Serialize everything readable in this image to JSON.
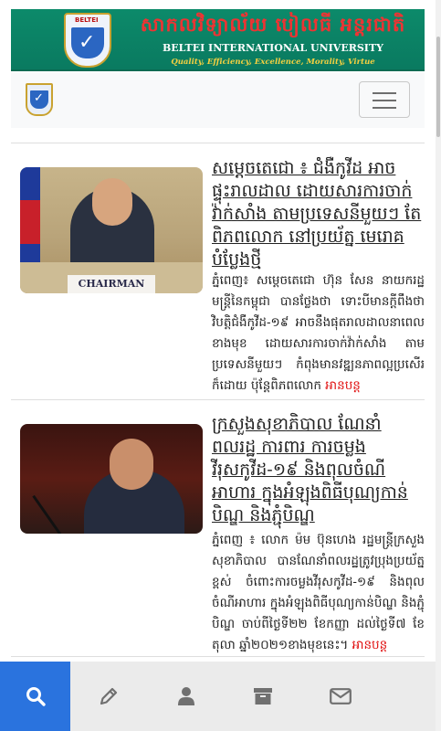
{
  "header": {
    "university_name_km": "សាកលវិទ្យាល័យ បៀលធី អន្តរជាតិ",
    "university_name_en": "BELTEI INTERNATIONAL UNIVERSITY",
    "motto": "Quality, Efficiency, Excellence, Morality, Virtue",
    "logo_caption": "BELTEI"
  },
  "navbar": {
    "brand_icon": "beltei-logo-icon",
    "menu_icon": "hamburger-icon"
  },
  "articles": [
    {
      "headline": "សម្តេចតេជោ ៖ ជំងឺកូវីដ អាចផ្ទុះរាលដាល ដោយសារការចាក់វ៉ាក់សាំង តាមប្រទេសនីមួយៗ តែពិភពលោក នៅប្រយ័ត្ន មេរោគបំប្លែងថ្មី",
      "summary": "ភ្នំពេញ៖ សម្តេចតេជោ ហ៊ុន សែន នាយករដ្ឋមន្ត្រីនៃកម្ពុជា បានថ្លែងថា ទោះបីមានក្តីពឹងថា វិបត្តិជំងឺកូវីដ-១៩ អាចនឹងផុតរាលដាលនាពេលខាងមុខ ដោយសារការចាក់វ៉ាក់សាំង តាមប្រទេសនីមួយៗ កំពុងមានវឌ្ឍនភាពល្អប្រសើរ ក៏ដោយ ប៉ុន្តែពិភពលោក",
      "more": "អានបន្ត",
      "image_caption": "CHAIRMAN"
    },
    {
      "headline": "ក្រសួងសុខាភិបាល ណែនាំពលរដ្ឋ ការពារ ការចម្លងវីរុសកូវីដ-១៩ និងពុលចំណីអាហារ ក្នុងអំឡុងពិធីបុណ្យកាន់បិណ្ឌ និងភ្ជុំបិណ្ឌ",
      "summary": "ភ្នំពេញ ៖ លោក ម៉ម ប៊ុនហេង រដ្ឋមន្ត្រីក្រសួងសុខាភិបាល បានណែនាំពលរដ្ឋត្រូវប្រុងប្រយ័ត្នខ្ពស់ ចំពោះការចម្លងវីរុសកូវីដ-១៩ និងពុលចំណីអាហារ ក្នុងអំឡុងពិធីបុណ្យកាន់បិណ្ឌ និងភ្ជុំបិណ្ឌ ចាប់ពីថ្ងៃទី២២ ខែកញ្ញា ដល់ថ្ងៃទី៧ ខែតុលា ឆ្នាំ២០២១ខាងមុខនេះ។",
      "more": "អានបន្ត"
    }
  ],
  "bottom_nav": [
    {
      "icon": "search-icon",
      "active": true
    },
    {
      "icon": "pencil-icon",
      "active": false
    },
    {
      "icon": "user-icon",
      "active": false
    },
    {
      "icon": "archive-icon",
      "active": false
    },
    {
      "icon": "envelope-icon",
      "active": false
    }
  ],
  "colors": {
    "banner_green": "#0c8a6a",
    "title_red": "#e33333",
    "motto_yellow": "#f5d040",
    "link_red": "#e01010",
    "nav_active_blue": "#2a73de"
  }
}
